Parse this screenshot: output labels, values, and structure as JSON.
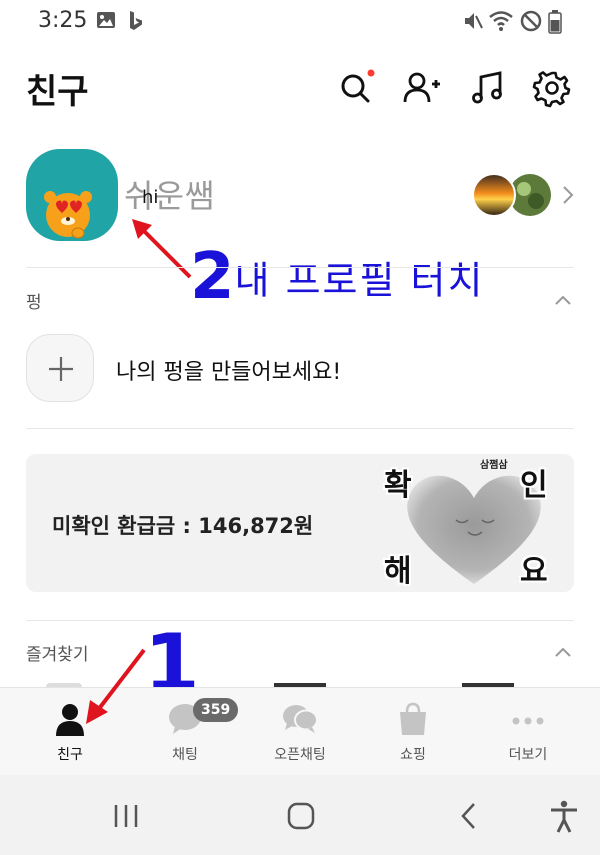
{
  "status_bar": {
    "time": "3:25",
    "icons_left": [
      "image-icon",
      "bing-icon"
    ],
    "icons_right": [
      "mute-icon",
      "wifi-icon",
      "no-disturb-icon",
      "battery-icon"
    ]
  },
  "header": {
    "title": "친구",
    "actions": [
      "search-icon",
      "add-friend-icon",
      "music-icon",
      "settings-icon"
    ],
    "search_has_notification_dot": true,
    "accent_dot_color": "#ff3b30"
  },
  "profile": {
    "name": "쉬운쌤",
    "status_message": "hi"
  },
  "annotations": {
    "step2_number": "2",
    "step2_text": "내 프로필 터치",
    "step1_number": "1",
    "color": "#1a12d8",
    "arrow_color": "#e0141e"
  },
  "pung": {
    "section_label": "펑",
    "cta_text": "나의 펑을 만들어보세요!"
  },
  "refund_banner": {
    "text": "미확인 환급금 : 146,872원",
    "brand_small": "삼쩜삼",
    "words": [
      "확",
      "인",
      "해",
      "요"
    ]
  },
  "favorites": {
    "section_label": "즐겨찾기"
  },
  "bottom_nav": {
    "items": [
      {
        "label": "친구",
        "icon": "person-icon",
        "active": true
      },
      {
        "label": "채팅",
        "icon": "chat-bubble-icon",
        "badge": "359"
      },
      {
        "label": "오픈채팅",
        "icon": "open-chat-icon"
      },
      {
        "label": "쇼핑",
        "icon": "shopping-bag-icon"
      },
      {
        "label": "더보기",
        "icon": "more-dots-icon"
      }
    ]
  },
  "system_nav": [
    "recent-apps-icon",
    "home-icon",
    "back-icon",
    "accessibility-icon"
  ]
}
